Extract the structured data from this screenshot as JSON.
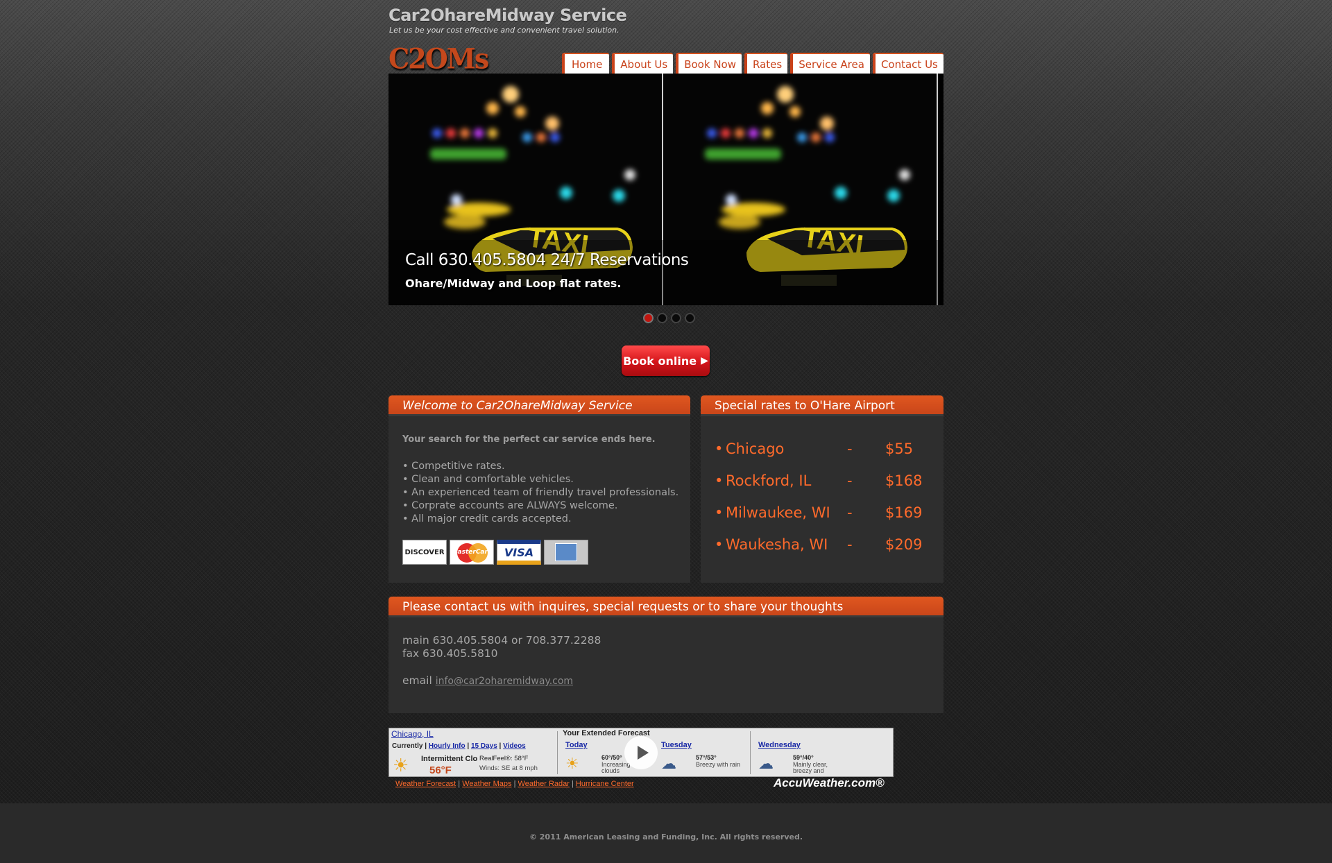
{
  "header": {
    "site_title": "Car2OhareMidway Service",
    "tagline": "Let us be your cost effective and convenient travel solution.",
    "logo": "C2OMs"
  },
  "nav": {
    "items": [
      {
        "label": "Home"
      },
      {
        "label": "About Us"
      },
      {
        "label": "Book Now"
      },
      {
        "label": "Rates"
      },
      {
        "label": "Service Area"
      },
      {
        "label": "Contact Us"
      }
    ]
  },
  "slider": {
    "caption_title": "Call 630.405.5804 24/7 Reservations",
    "caption_sub": "Ohare/Midway and Loop flat rates.",
    "taxi_sign": "TAXI",
    "slide_count": 4,
    "active_slide": 1
  },
  "book_button": {
    "label": "Book online"
  },
  "welcome": {
    "heading": "Welcome to Car2OhareMidway Service",
    "intro": "Your search for the perfect car service ends here.",
    "bullets": [
      "• Competitive rates.",
      "• Clean and comfortable vehicles.",
      "• An experienced team of friendly travel professionals.",
      "• Corprate accounts are ALWAYS welcome.",
      "• All major credit cards accepted."
    ],
    "cards": {
      "discover": "DISCOVER",
      "mastercard": "MasterCard",
      "visa": "VISA"
    }
  },
  "special_rates": {
    "heading": "Special rates to O'Hare Airport",
    "rows": [
      {
        "place": "Chicago",
        "dash": "-",
        "price": "$55"
      },
      {
        "place": "Rockford, IL",
        "dash": "-",
        "price": "$168"
      },
      {
        "place": "Milwaukee, WI",
        "dash": "-",
        "price": "$169"
      },
      {
        "place": "Waukesha, WI",
        "dash": "-",
        "price": "$209"
      }
    ]
  },
  "contact": {
    "heading": "Please contact us with inquires, special requests or to share your thoughts",
    "main": "main 630.405.5804 or 708.377.2288",
    "fax": "fax 630.405.5810",
    "email_label": "email",
    "email": "info@car2oharemidway.com"
  },
  "weather": {
    "location": "Chicago, IL",
    "currently": "Currently",
    "hourly": "Hourly Info",
    "days15": "15 Days",
    "videos": "Videos",
    "condition": "Intermittent Clo",
    "realfeel": "RealFeel®: 58°F",
    "winds": "Winds: SE at 8 mph",
    "temp": "56°F",
    "extended": "Your Extended Forecast",
    "days": [
      {
        "name": "Today",
        "temps": "60°/50°",
        "desc": "Increasing clouds"
      },
      {
        "name": "Tuesday",
        "temps": "57°/53°",
        "desc": "Breezy with rain"
      },
      {
        "name": "Wednesday",
        "temps": "59°/40°",
        "desc": "Mainly clear, breezy and"
      }
    ],
    "links": [
      "Weather Forecast",
      "Weather Maps",
      "Weather Radar",
      "Hurricane Center"
    ],
    "brand": "AccuWeather.com®"
  },
  "footer": {
    "copyright": "© 2011 American Leasing and Funding, Inc. All rights reserved."
  },
  "colors": {
    "accent": "#c9461a",
    "rate_text": "#ff6a2b",
    "book_button": "#d4141a"
  }
}
